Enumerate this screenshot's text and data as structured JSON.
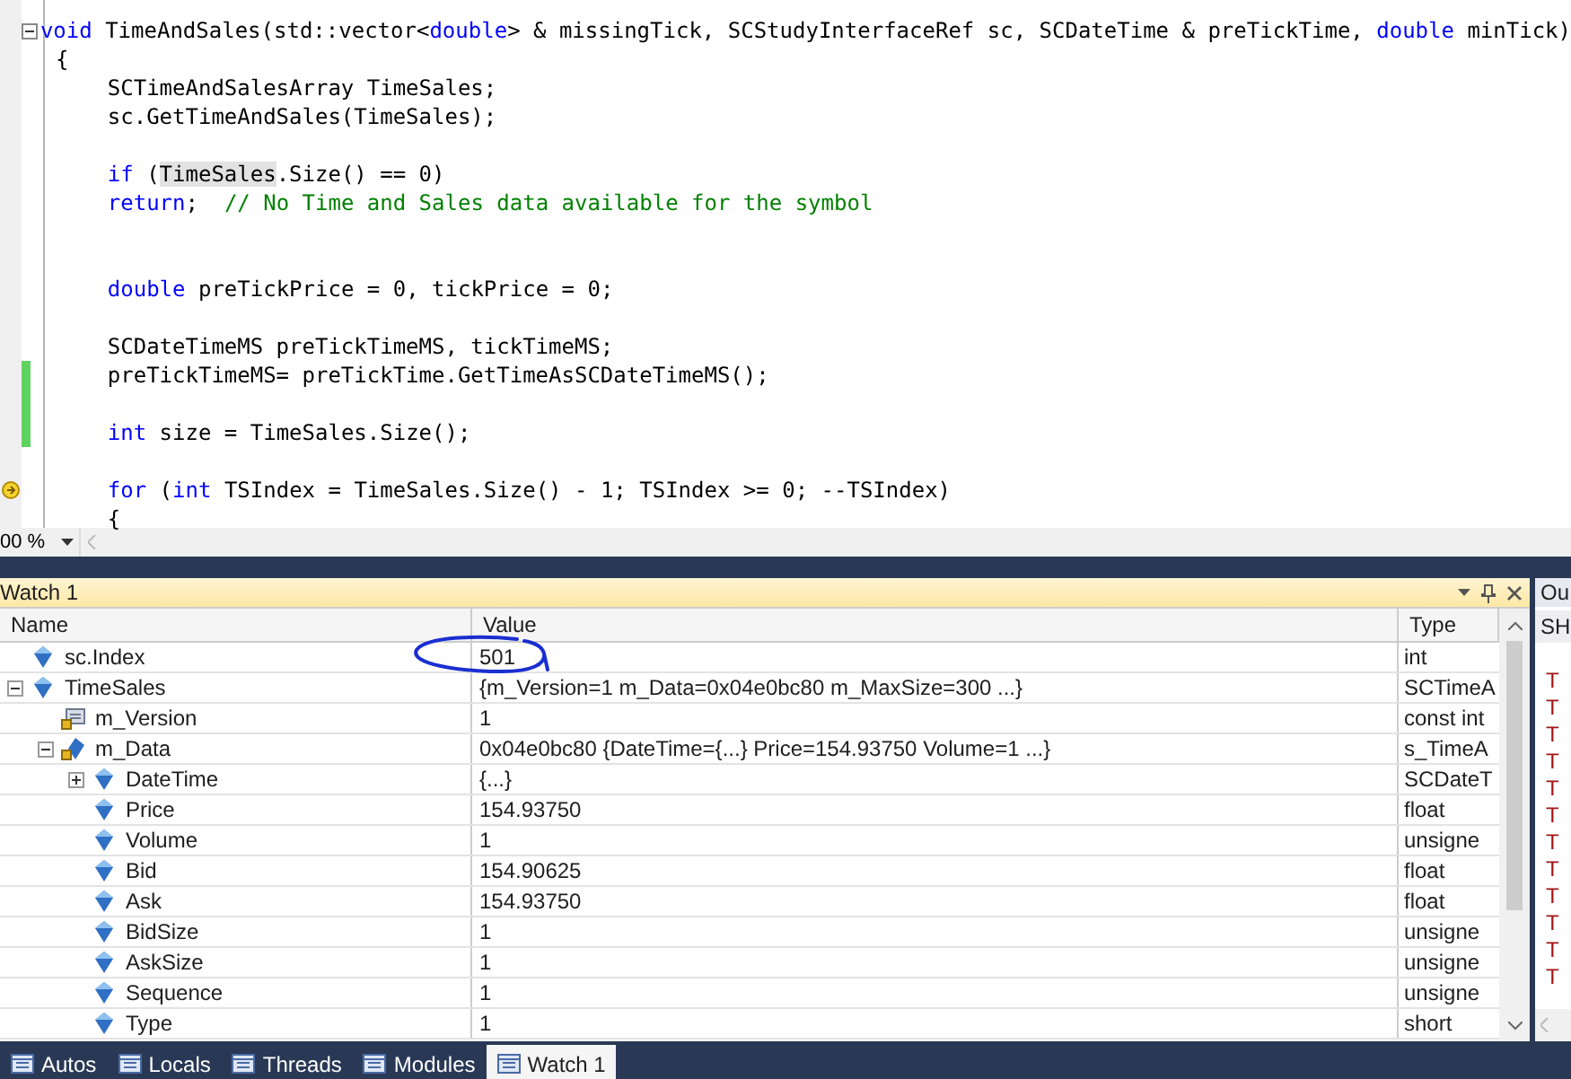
{
  "code_editor": {
    "lines": [
      {
        "kind": "fold",
        "indented": false,
        "changed": false,
        "segments": [
          {
            "kind": "keyword",
            "text": "void"
          },
          {
            "kind": "plain",
            "text": " TimeAndSales(std::vector<"
          },
          {
            "kind": "keyword",
            "text": "double"
          },
          {
            "kind": "plain",
            "text": "> & missingTick, SCStudyInterfaceRef sc, SCDateTime & preTickTime, "
          },
          {
            "kind": "keyword",
            "text": "double"
          },
          {
            "kind": "plain",
            "text": " minTick)"
          }
        ]
      },
      {
        "kind": "code",
        "indented": false,
        "changed": false,
        "segments": [
          {
            "kind": "plain",
            "text": "{"
          }
        ]
      },
      {
        "kind": "code",
        "indented": true,
        "changed": false,
        "segments": [
          {
            "kind": "plain",
            "text": "SCTimeAndSalesArray TimeSales;"
          }
        ]
      },
      {
        "kind": "code",
        "indented": true,
        "changed": false,
        "segments": [
          {
            "kind": "plain",
            "text": "sc.GetTimeAndSales(TimeSales);"
          }
        ]
      },
      {
        "kind": "blank"
      },
      {
        "kind": "code",
        "indented": true,
        "changed": false,
        "segments": [
          {
            "kind": "keyword",
            "text": "if"
          },
          {
            "kind": "plain",
            "text": " ("
          },
          {
            "kind": "highlight",
            "text": "TimeSales"
          },
          {
            "kind": "plain",
            "text": ".Size() == 0)"
          }
        ]
      },
      {
        "kind": "code",
        "indented": true,
        "changed": false,
        "segments": [
          {
            "kind": "keyword",
            "text": "return"
          },
          {
            "kind": "plain",
            "text": ";  "
          },
          {
            "kind": "comment",
            "text": "// No Time and Sales data available for the symbol"
          }
        ]
      },
      {
        "kind": "blank"
      },
      {
        "kind": "blank"
      },
      {
        "kind": "code",
        "indented": true,
        "changed": false,
        "segments": [
          {
            "kind": "keyword",
            "text": "double"
          },
          {
            "kind": "plain",
            "text": " preTickPrice = 0, tickPrice = 0;"
          }
        ]
      },
      {
        "kind": "blank"
      },
      {
        "kind": "code",
        "indented": true,
        "changed": false,
        "segments": [
          {
            "kind": "plain",
            "text": "SCDateTimeMS preTickTimeMS, tickTimeMS;"
          }
        ]
      },
      {
        "kind": "code",
        "indented": true,
        "changed": true,
        "segments": [
          {
            "kind": "plain",
            "text": "preTickTimeMS= preTickTime.GetTimeAsSCDateTimeMS();"
          }
        ]
      },
      {
        "kind": "blank",
        "changed": true
      },
      {
        "kind": "code",
        "indented": true,
        "changed": true,
        "segments": [
          {
            "kind": "keyword",
            "text": "int"
          },
          {
            "kind": "plain",
            "text": " size = TimeSales.Size();"
          }
        ]
      },
      {
        "kind": "blank"
      },
      {
        "kind": "current",
        "indented": true,
        "changed": false,
        "segments": [
          {
            "kind": "keyword",
            "text": "for"
          },
          {
            "kind": "plain",
            "text": " ("
          },
          {
            "kind": "keyword",
            "text": "int"
          },
          {
            "kind": "plain",
            "text": " TSIndex = TimeSales.Size() - 1; TSIndex >= 0; --TSIndex)"
          }
        ]
      },
      {
        "kind": "code",
        "indented": true,
        "changed": false,
        "segments": [
          {
            "kind": "plain",
            "text": "{"
          }
        ]
      }
    ]
  },
  "zoom_bar": {
    "zoom": "00 %"
  },
  "watch_panel": {
    "title": "Watch 1",
    "columns": [
      "Name",
      "Value",
      "Type"
    ],
    "ink_circle": true,
    "rows": [
      {
        "kind": "field",
        "name": "sc.Index",
        "value": "501",
        "type": "int"
      },
      {
        "kind": "field",
        "name": "TimeSales",
        "value": "{m_Version=1 m_Data=0x04e0bc80 m_MaxSize=300 ...}",
        "type": "SCTimeA",
        "expanded": true,
        "children": [
          {
            "kind": "constant",
            "name": "m_Version",
            "value": "1",
            "type": "const int"
          },
          {
            "kind": "pointer",
            "name": "m_Data",
            "value": "0x04e0bc80 {DateTime={...} Price=154.93750 Volume=1 ...}",
            "type": "s_TimeA",
            "expanded": true,
            "children": [
              {
                "kind": "field",
                "name": "DateTime",
                "value": "{...}",
                "type": "SCDateT",
                "expanded": false
              },
              {
                "kind": "field",
                "name": "Price",
                "value": "154.93750",
                "type": "float"
              },
              {
                "kind": "field",
                "name": "Volume",
                "value": "1",
                "type": "unsigne"
              },
              {
                "kind": "field",
                "name": "Bid",
                "value": "154.90625",
                "type": "float"
              },
              {
                "kind": "field",
                "name": "Ask",
                "value": "154.93750",
                "type": "float"
              },
              {
                "kind": "field",
                "name": "BidSize",
                "value": "1",
                "type": "unsigne"
              },
              {
                "kind": "field",
                "name": "AskSize",
                "value": "1",
                "type": "unsigne"
              },
              {
                "kind": "field",
                "name": "Sequence",
                "value": "1",
                "type": "unsigne"
              },
              {
                "kind": "field",
                "name": "Type",
                "value": "1",
                "type": "short"
              }
            ]
          }
        ]
      }
    ]
  },
  "output_panel": {
    "title": "Ou",
    "header": "SH",
    "lines": [
      "T",
      "T",
      "T",
      "T",
      "T",
      "T",
      "T",
      "T",
      "T",
      "T",
      "T",
      "T"
    ]
  },
  "bottom_tabs": [
    {
      "label": "Autos",
      "selected": false
    },
    {
      "label": "Locals",
      "selected": false
    },
    {
      "label": "Threads",
      "selected": false
    },
    {
      "label": "Modules",
      "selected": false
    },
    {
      "label": "Watch 1",
      "selected": true
    }
  ]
}
